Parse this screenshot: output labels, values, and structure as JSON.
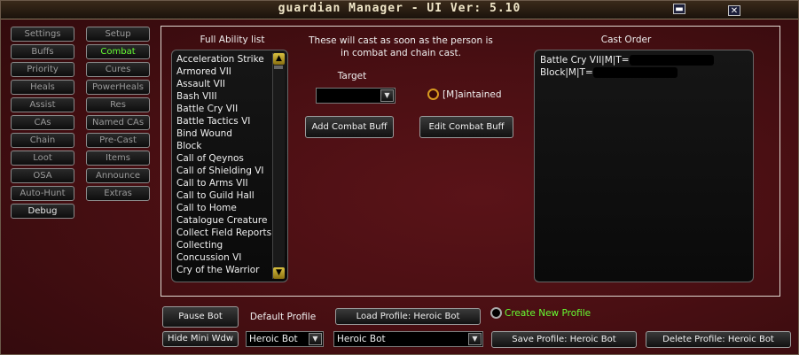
{
  "window": {
    "title": "guardian Manager  - UI Ver: 5.10",
    "min_icon": "minimize-icon",
    "close_icon": "close-icon",
    "close_glyph": "✕",
    "min_glyph": "▬"
  },
  "nav": {
    "left": [
      "Settings",
      "Buffs",
      "Priority",
      "Heals",
      "Assist",
      "CAs",
      "Chain",
      "Loot",
      "OSA",
      "Auto-Hunt",
      "Debug"
    ],
    "right": [
      "Setup",
      "Combat",
      "Cures",
      "PowerHeals",
      "Res",
      "Named CAs",
      "Pre-Cast",
      "Items",
      "Announce",
      "Extras"
    ],
    "active": "Combat"
  },
  "ability_list": {
    "header": "Full Ability list",
    "items": [
      "Acceleration Strike",
      "Armored VII",
      "Assault VII",
      "Bash VIII",
      "Battle Cry VII",
      "Battle Tactics VI",
      "Bind Wound",
      "Block",
      "Call of Qeynos",
      "Call of Shielding VI",
      "Call to Arms VII",
      "Call to Guild Hall",
      "Call to Home",
      "Catalogue Creature",
      "Collect Field Reports",
      "Collecting",
      "Concussion VI",
      "Cry of the Warrior"
    ]
  },
  "info_text": "These will cast as soon as the person is in combat and chain cast.",
  "target": {
    "label": "Target",
    "value": ""
  },
  "maintained": {
    "label": "[M]aintained"
  },
  "buttons": {
    "add_combat_buff": "Add Combat Buff",
    "edit_combat_buff": "Edit Combat Buff",
    "pause_bot": "Pause Bot",
    "hide_mini_wdw": "Hide Mini Wdw",
    "load_profile": "Load Profile: Heroic Bot",
    "save_profile": "Save Profile: Heroic Bot",
    "delete_profile": "Delete Profile: Heroic Bot"
  },
  "cast_order": {
    "header": "Cast Order",
    "items": [
      "Battle Cry VII|M|T=",
      "Block|M|T="
    ]
  },
  "profile": {
    "default_label": "Default Profile",
    "small_dropdown_value": "Heroic Bot",
    "large_dropdown_value": "Heroic Bot",
    "create_new_label": "Create New Profile"
  },
  "colors": {
    "active_green": "#66ff33",
    "radio_gold": "#d89a20"
  }
}
